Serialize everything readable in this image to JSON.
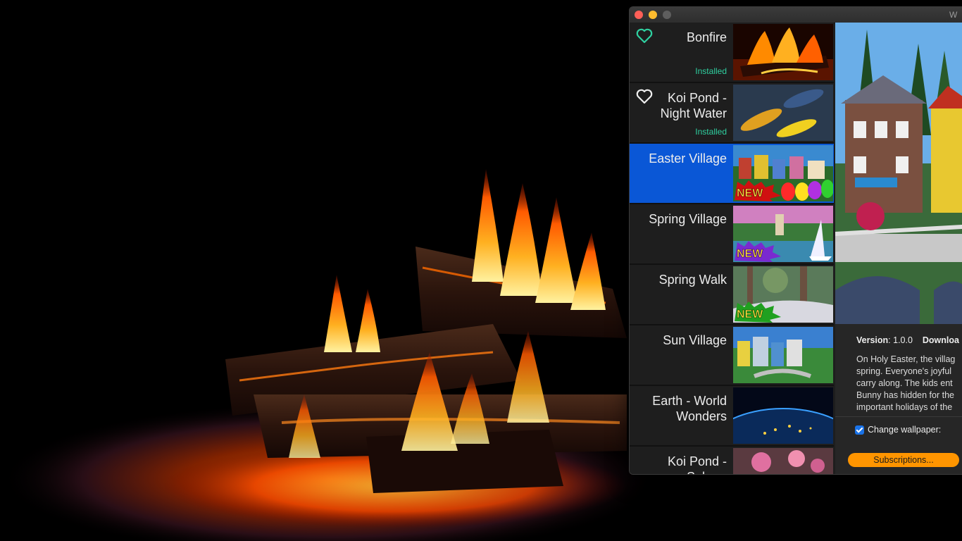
{
  "window": {
    "title": "W"
  },
  "items": [
    {
      "name": "Bonfire",
      "status": "Installed",
      "favorite": true,
      "selected": false,
      "new": false
    },
    {
      "name": "Koi Pond - Night Water",
      "status": "Installed",
      "favorite": false,
      "selected": false,
      "new": false
    },
    {
      "name": "Easter Village",
      "status": "",
      "favorite": null,
      "selected": true,
      "new": true
    },
    {
      "name": "Spring Village",
      "status": "",
      "favorite": null,
      "selected": false,
      "new": true
    },
    {
      "name": "Spring Walk",
      "status": "",
      "favorite": null,
      "selected": false,
      "new": true
    },
    {
      "name": "Sun Village",
      "status": "",
      "favorite": null,
      "selected": false,
      "new": false
    },
    {
      "name": "Earth - World Wonders",
      "status": "",
      "favorite": null,
      "selected": false,
      "new": false
    },
    {
      "name": "Koi Pond - Sakura",
      "status": "",
      "favorite": null,
      "selected": false,
      "new": false
    }
  ],
  "badge": {
    "text": "NEW"
  },
  "details": {
    "version_label": "Version",
    "version_value": ": 1.0.0",
    "download_label": "Downloa",
    "description_lines": [
      "On Holy Easter, the villag",
      "spring. Everyone's joyful",
      "carry along. The kids ent",
      "Bunny has hidden for the",
      "important holidays of the"
    ],
    "change_wallpaper_label": "Change wallpaper:",
    "change_wallpaper_checked": true,
    "subscriptions_label": "Subscriptions..."
  },
  "colors": {
    "selection": "#0a57d6",
    "installed": "#2fd0a0",
    "favorite_heart": "#2fd0a0",
    "button": "#ff9500"
  },
  "icons": {
    "favorite": "heart-icon",
    "checkbox": "checkmark-icon"
  }
}
